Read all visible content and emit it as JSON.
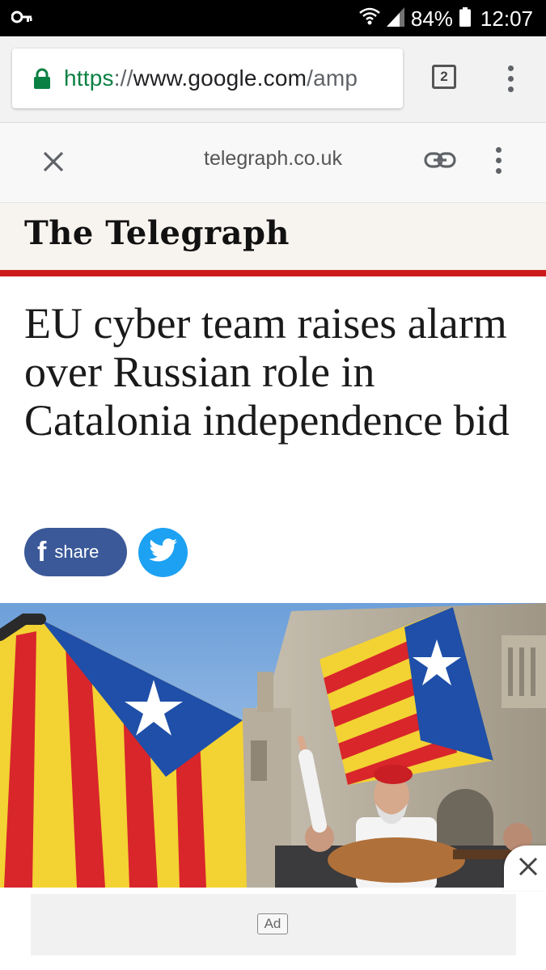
{
  "status_bar": {
    "battery_percent": "84%",
    "time": "12:07",
    "icons": [
      "vpn-key-icon",
      "wifi-icon",
      "signal-icon",
      "battery-icon"
    ]
  },
  "browser": {
    "url_scheme": "https",
    "url_separator": "://",
    "url_host": "www.google.com",
    "url_path": "/amp",
    "tab_count": "2",
    "colors": {
      "secure_green": "#0b8043"
    }
  },
  "amp_viewer": {
    "domain": "telegraph.co.uk"
  },
  "masthead": {
    "logo_text": "The Telegraph",
    "accent_color": "#cc1a1a"
  },
  "article": {
    "headline": "EU cyber team raises alarm over Russian role in Catalonia independence bid",
    "share": {
      "facebook_icon": "f",
      "facebook_label": "share",
      "facebook_color": "#3b5998",
      "twitter_color": "#1da1f2"
    },
    "image_semantic": "protest-photo-catalan-flags"
  },
  "ad": {
    "badge": "Ad"
  }
}
